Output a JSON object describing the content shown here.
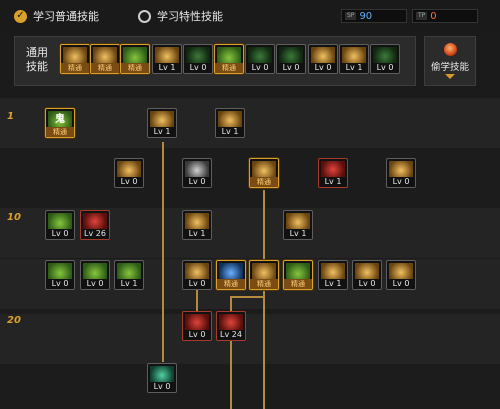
{
  "header": {
    "tab_normal": "学习普通技能",
    "tab_special": "学习特性技能",
    "sp": [
      {
        "tag": "SP",
        "value": "90",
        "color": "#5fb0ff"
      },
      {
        "tag": "TP",
        "value": "0",
        "color": "#ff6a3d"
      }
    ]
  },
  "common": {
    "label_line1": "通用",
    "label_line2": "技能",
    "skills": [
      {
        "cap": "精通",
        "icon": "ic-gold"
      },
      {
        "cap": "精通",
        "icon": "ic-gold"
      },
      {
        "cap": "精通",
        "icon": "ic-green"
      },
      {
        "cap": "Lv 1",
        "icon": "ic-gold"
      },
      {
        "cap": "Lv 0",
        "icon": "ic-dgreen"
      },
      {
        "cap": "精通",
        "icon": "ic-green"
      },
      {
        "cap": "Lv 0",
        "icon": "ic-dgreen"
      },
      {
        "cap": "Lv 0",
        "icon": "ic-dgreen"
      },
      {
        "cap": "Lv 0",
        "icon": "ic-gold"
      },
      {
        "cap": "Lv 1",
        "icon": "ic-gold"
      },
      {
        "cap": "Lv 0",
        "icon": "ic-dgreen"
      }
    ]
  },
  "steal": {
    "label": "偷学技能"
  },
  "tree": {
    "levels": [
      "1",
      "10",
      "20"
    ],
    "slots": [
      {
        "cap": "精通",
        "icon": "ic-green",
        "icon_text": "鬼"
      },
      {
        "cap": "Lv 1",
        "icon": "ic-gold"
      },
      {
        "cap": "Lv 1",
        "icon": "ic-gold"
      },
      {
        "cap": "Lv 0",
        "icon": "ic-gold"
      },
      {
        "cap": "Lv 0",
        "icon": "ic-grey"
      },
      {
        "cap": "精通",
        "icon": "ic-gold"
      },
      {
        "cap": "Lv 1",
        "icon": "ic-red"
      },
      {
        "cap": "Lv 0",
        "icon": "ic-gold"
      },
      {
        "cap": "Lv 0",
        "icon": "ic-green"
      },
      {
        "cap": "Lv 26",
        "icon": "ic-red"
      },
      {
        "cap": "Lv 1",
        "icon": "ic-gold"
      },
      {
        "cap": "Lv 1",
        "icon": "ic-gold"
      },
      {
        "cap": "Lv 0",
        "icon": "ic-green"
      },
      {
        "cap": "Lv 0",
        "icon": "ic-green"
      },
      {
        "cap": "Lv 1",
        "icon": "ic-green"
      },
      {
        "cap": "Lv 0",
        "icon": "ic-gold"
      },
      {
        "cap": "精通",
        "icon": "ic-blue"
      },
      {
        "cap": "精通",
        "icon": "ic-gold"
      },
      {
        "cap": "精通",
        "icon": "ic-green"
      },
      {
        "cap": "Lv 1",
        "icon": "ic-gold"
      },
      {
        "cap": "Lv 0",
        "icon": "ic-gold"
      },
      {
        "cap": "Lv 0",
        "icon": "ic-gold"
      },
      {
        "cap": "Lv 0",
        "icon": "ic-red"
      },
      {
        "cap": "Lv 24",
        "icon": "ic-red"
      },
      {
        "cap": "Lv 0",
        "icon": "ic-teal"
      }
    ]
  }
}
